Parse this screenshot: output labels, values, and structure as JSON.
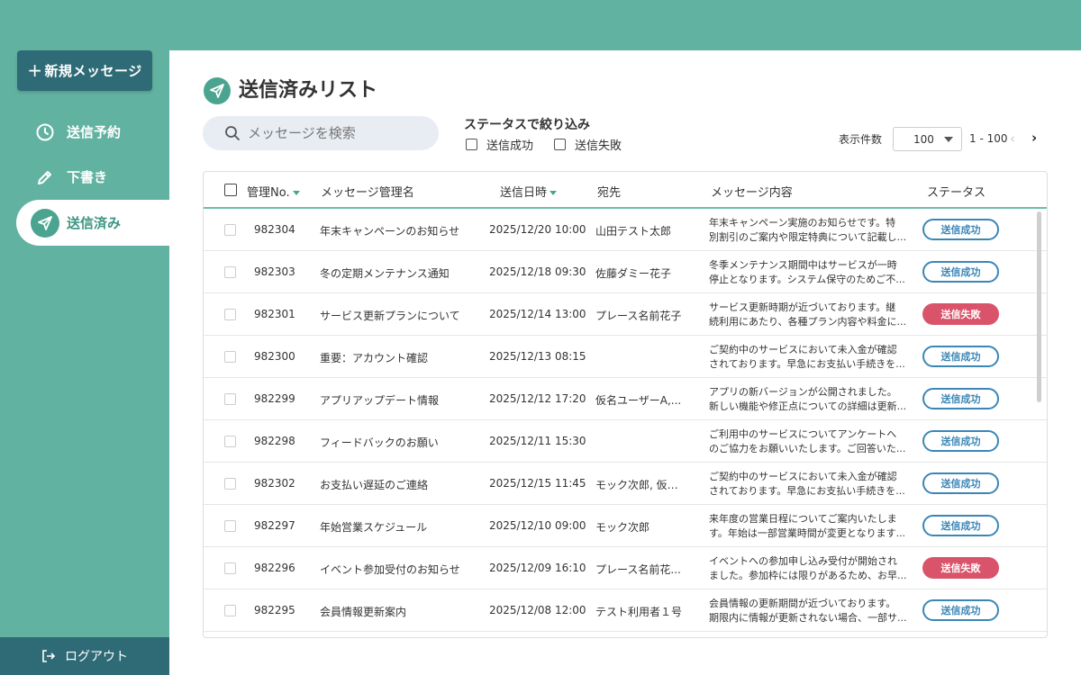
{
  "sidebar": {
    "new_message": "新規メッセージ",
    "items": [
      {
        "label": "送信予約",
        "icon": "clock-icon"
      },
      {
        "label": "下書き",
        "icon": "pencil-icon"
      },
      {
        "label": "送信済み",
        "icon": "paper-plane-icon",
        "active": true
      }
    ],
    "logout": "ログアウト"
  },
  "main": {
    "title": "送信済みリスト",
    "search": {
      "placeholder": "メッセージを検索",
      "value": ""
    },
    "filter": {
      "title": "ステータスで絞り込み",
      "options": [
        {
          "label": "送信成功",
          "checked": false
        },
        {
          "label": "送信失敗",
          "checked": false
        }
      ]
    },
    "pagination": {
      "per_page_label": "表示件数",
      "per_page_value": "100",
      "range": "1 - 100",
      "prev": "‹",
      "next": "›"
    },
    "table": {
      "columns": [
        "管理No.",
        "メッセージ管理名",
        "送信日時",
        "宛先",
        "メッセージ内容",
        "ステータス"
      ],
      "rows": [
        {
          "id": "982304",
          "name": "年末キャンペーンのお知らせ",
          "date": "2025/12/20 10:00",
          "to": "山田テスト太郎",
          "content1": "年末キャンペーン実施のお知らせです。特",
          "content2": "別割引のご案内や限定特典について記載し...",
          "status": "送信成功",
          "ok": true
        },
        {
          "id": "982303",
          "name": "冬の定期メンテナンス通知",
          "date": "2025/12/18 09:30",
          "to": "佐藤ダミー花子",
          "content1": "冬季メンテナンス期間中はサービスが一時",
          "content2": "停止となります。システム保守のためご不...",
          "status": "送信成功",
          "ok": true
        },
        {
          "id": "982301",
          "name": "サービス更新プランについて",
          "date": "2025/12/14 13:00",
          "to": "プレース名前花子",
          "content1": "サービス更新時期が近づいております。継",
          "content2": "続利用にあたり、各種プラン内容や料金に...",
          "status": "送信失敗",
          "ok": false
        },
        {
          "id": "982300",
          "name": "重要：アカウント確認",
          "date": "2025/12/13 08:15",
          "to": "",
          "content1": "ご契約中のサービスにおいて未入金が確認",
          "content2": "されております。早急にお支払い手続きを...",
          "status": "送信成功",
          "ok": true
        },
        {
          "id": "982299",
          "name": "アプリアップデート情報",
          "date": "2025/12/12 17:20",
          "to": "仮名ユーザーA,...",
          "content1": "アプリの新バージョンが公開されました。",
          "content2": "新しい機能や修正点についての詳細は更新...",
          "status": "送信成功",
          "ok": true
        },
        {
          "id": "982298",
          "name": "フィードバックのお願い",
          "date": "2025/12/11 15:30",
          "to": "",
          "content1": "ご利用中のサービスについてアンケートへ",
          "content2": "のご協力をお願いいたします。ご回答いた...",
          "status": "送信成功",
          "ok": true
        },
        {
          "id": "982302",
          "name": "お支払い遅延のご連絡",
          "date": "2025/12/15 11:45",
          "to": "モック次郎, 仮名...",
          "content1": "ご契約中のサービスにおいて未入金が確認",
          "content2": "されております。早急にお支払い手続きを...",
          "status": "送信成功",
          "ok": true
        },
        {
          "id": "982297",
          "name": "年始営業スケジュール",
          "date": "2025/12/10 09:00",
          "to": "モック次郎",
          "content1": "来年度の営業日程についてご案内いたしま",
          "content2": "す。年始は一部営業時間が変更となります...",
          "status": "送信成功",
          "ok": true
        },
        {
          "id": "982296",
          "name": "イベント参加受付のお知らせ",
          "date": "2025/12/09 16:10",
          "to": "プレース名前花...",
          "content1": "イベントへの参加申し込み受付が開始され",
          "content2": "ました。参加枠には限りがあるため、お早...",
          "status": "送信失敗",
          "ok": false
        },
        {
          "id": "982295",
          "name": "会員情報更新案内",
          "date": "2025/12/08 12:00",
          "to": "テスト利用者１号",
          "content1": "会員情報の更新期間が近づいております。",
          "content2": "期限内に情報が更新されない場合、一部サ...",
          "status": "送信成功",
          "ok": true
        }
      ]
    }
  },
  "colors": {
    "teal": "#62b2a1",
    "dark_teal": "#2f6b76",
    "success": "#3a86b6",
    "failure": "#d9546a"
  }
}
